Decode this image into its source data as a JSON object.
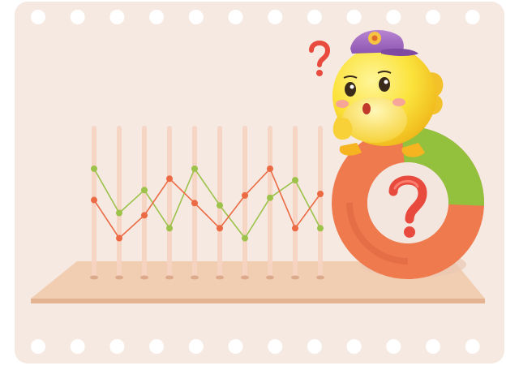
{
  "palette": {
    "card": "#f5e9e1",
    "hole": "#ffffff",
    "platform_top": "#f1cdb1",
    "platform_front": "#e4b392",
    "pillar": "#f6d3c2",
    "series_green": "#9cc24a",
    "series_orange": "#ec6a43",
    "donut_orange": "#ee7a4e",
    "donut_green": "#93c13d",
    "donut_inner": "#f3e6de",
    "question_red": "#e84b3e",
    "chick_yellow": "#fbe33c",
    "cap_purple": "#a06bc0"
  },
  "illustration": {
    "pillar_count": 10,
    "green_series": [
      0.83,
      0.25,
      0.55,
      0.05,
      0.83,
      0.35,
      -0.08,
      0.45,
      0.68,
      0.05
    ],
    "orange_series": [
      0.42,
      -0.08,
      0.22,
      0.7,
      0.38,
      0.05,
      0.48,
      0.83,
      0.05,
      0.5
    ],
    "donut_green_fraction": 0.27,
    "icons": [
      "question-mark-icon",
      "chick-mascot",
      "cap-icon"
    ]
  }
}
